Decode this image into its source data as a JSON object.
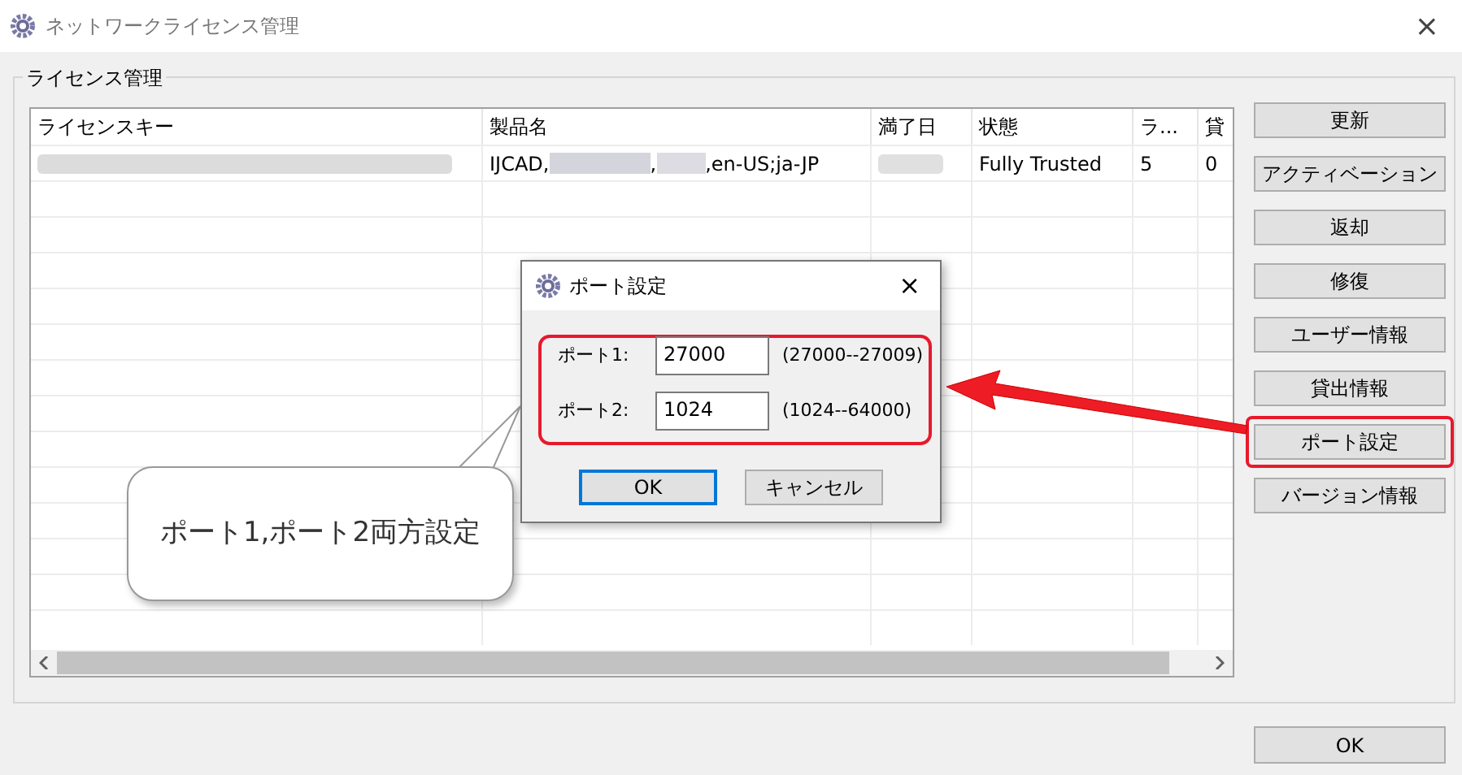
{
  "window": {
    "title": "ネットワークライセンス管理",
    "close": "×"
  },
  "group": {
    "title": "ライセンス管理"
  },
  "table": {
    "columns": [
      "ライセンスキー",
      "製品名",
      "満了日",
      "状態",
      "ラ...",
      "貸"
    ],
    "rows": [
      {
        "product_parts": [
          "IJCAD,",
          ",",
          ",en-US;ja-JP"
        ],
        "status": "Fully Trusted",
        "column_5": "5",
        "column_6": "0"
      }
    ]
  },
  "buttons": [
    {
      "label": "更新",
      "highlighted": false
    },
    {
      "label": "アクティベーション",
      "highlighted": false
    },
    {
      "label": "返却",
      "highlighted": false
    },
    {
      "label": "修復",
      "highlighted": false
    },
    {
      "label": "ユーザー情報",
      "highlighted": false
    },
    {
      "label": "貸出情報",
      "highlighted": false
    },
    {
      "label": "ポート設定",
      "highlighted": true
    },
    {
      "label": "バージョン情報",
      "highlighted": false
    }
  ],
  "ok_button": "OK",
  "dialog": {
    "title": "ポート設定",
    "close": "×",
    "ports": [
      {
        "label": "ポート1:",
        "value": "27000",
        "range": "(27000--27009)"
      },
      {
        "label": "ポート2:",
        "value": "1024",
        "range": "(1024--64000)"
      }
    ],
    "ok": "OK",
    "cancel": "キャンセル"
  },
  "callout": "ポート1,ポート2両方設定"
}
